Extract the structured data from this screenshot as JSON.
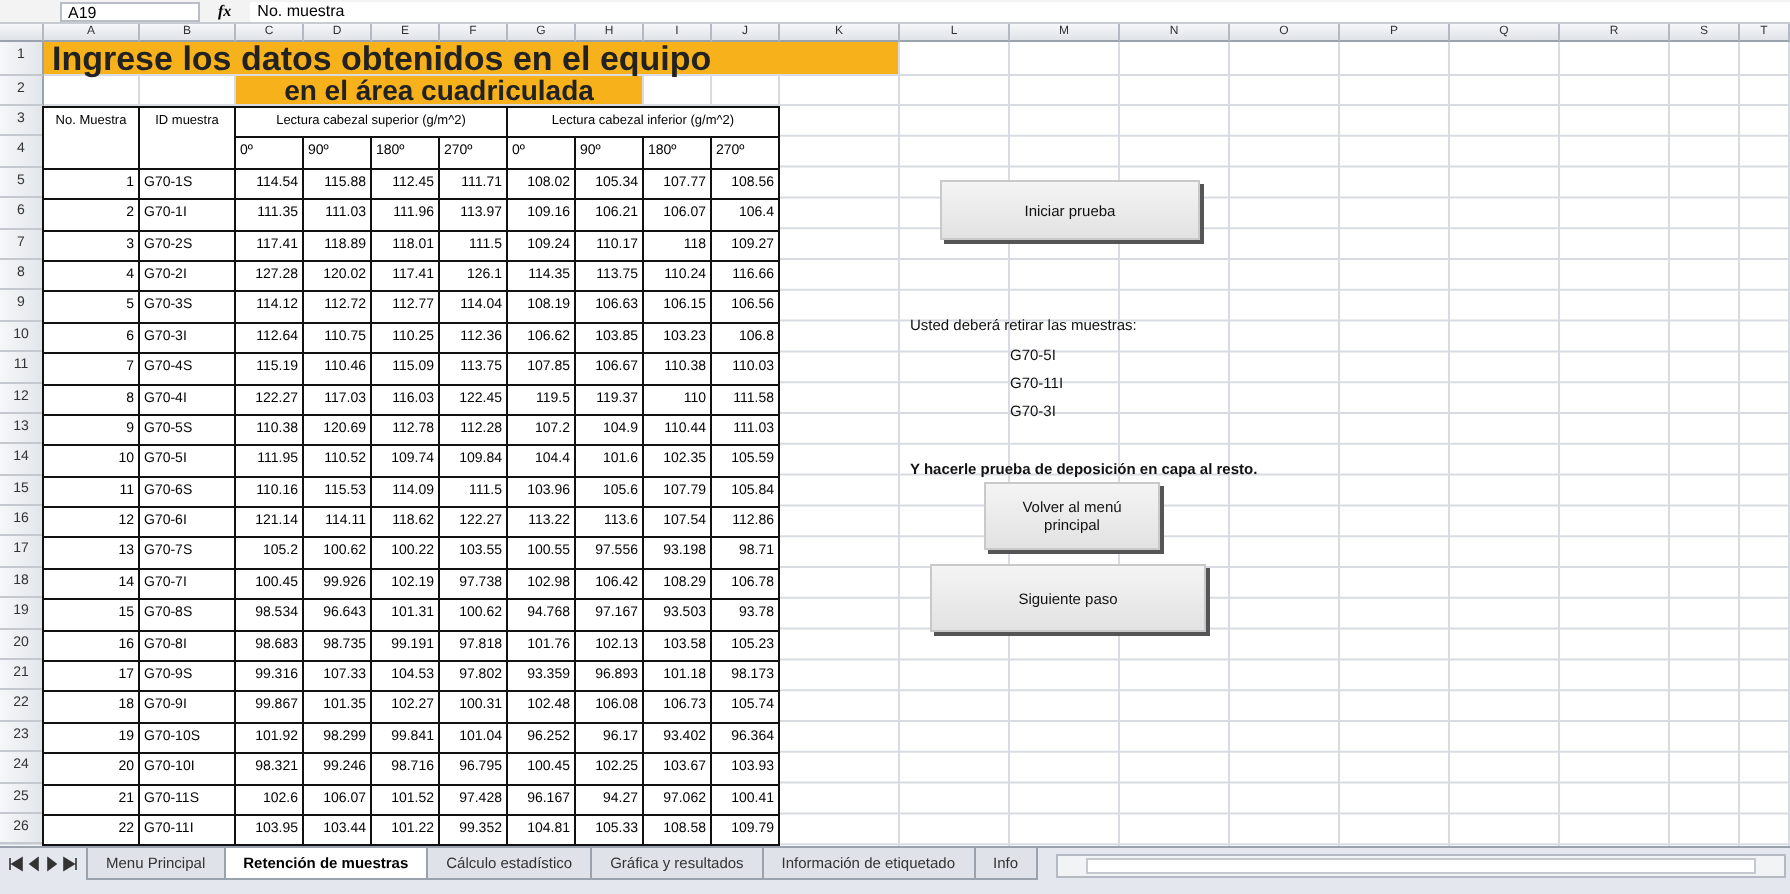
{
  "formula_bar": {
    "name_box": "A19",
    "function_label": "fx",
    "value": "No. muestra"
  },
  "row_numbers": [
    "1",
    "2",
    "3",
    "4",
    "5",
    "6",
    "7",
    "8",
    "9",
    "10",
    "11",
    "12",
    "13",
    "14",
    "15",
    "16",
    "17",
    "18",
    "19",
    "20",
    "21",
    "22",
    "23",
    "24",
    "25",
    "26"
  ],
  "columns": [
    "A",
    "B",
    "C",
    "D",
    "E",
    "F",
    "G",
    "H",
    "I",
    "J",
    "K",
    "L",
    "M",
    "N",
    "O",
    "P",
    "Q",
    "R",
    "S",
    "T"
  ],
  "title": {
    "line_1": "Ingrese los datos obtenidos en el equipo",
    "line_2": "en el área cuadriculada"
  },
  "table": {
    "headers": {
      "number": "No. Muestra",
      "id": "ID muestra",
      "upper": "Lectura cabezal superior (g/m^2)",
      "lower": "Lectura cabezal inferior (g/m^2)",
      "angles_upper": [
        "0º",
        "90º",
        "180º",
        "270º"
      ],
      "angles_lower": [
        "0º",
        "90º",
        "180º",
        "270º"
      ]
    },
    "rows": [
      [
        "1",
        "G70-1S",
        "114.54",
        "115.88",
        "112.45",
        "111.71",
        "108.02",
        "105.34",
        "107.77",
        "108.56"
      ],
      [
        "2",
        "G70-1I",
        "111.35",
        "111.03",
        "111.96",
        "113.97",
        "109.16",
        "106.21",
        "106.07",
        "106.4"
      ],
      [
        "3",
        "G70-2S",
        "117.41",
        "118.89",
        "118.01",
        "111.5",
        "109.24",
        "110.17",
        "118",
        "109.27"
      ],
      [
        "4",
        "G70-2I",
        "127.28",
        "120.02",
        "117.41",
        "126.1",
        "114.35",
        "113.75",
        "110.24",
        "116.66"
      ],
      [
        "5",
        "G70-3S",
        "114.12",
        "112.72",
        "112.77",
        "114.04",
        "108.19",
        "106.63",
        "106.15",
        "106.56"
      ],
      [
        "6",
        "G70-3I",
        "112.64",
        "110.75",
        "110.25",
        "112.36",
        "106.62",
        "103.85",
        "103.23",
        "106.8"
      ],
      [
        "7",
        "G70-4S",
        "115.19",
        "110.46",
        "115.09",
        "113.75",
        "107.85",
        "106.67",
        "110.38",
        "110.03"
      ],
      [
        "8",
        "G70-4I",
        "122.27",
        "117.03",
        "116.03",
        "122.45",
        "119.5",
        "119.37",
        "110",
        "111.58"
      ],
      [
        "9",
        "G70-5S",
        "110.38",
        "120.69",
        "112.78",
        "112.28",
        "107.2",
        "104.9",
        "110.44",
        "111.03"
      ],
      [
        "10",
        "G70-5I",
        "111.95",
        "110.52",
        "109.74",
        "109.84",
        "104.4",
        "101.6",
        "102.35",
        "105.59"
      ],
      [
        "11",
        "G70-6S",
        "110.16",
        "115.53",
        "114.09",
        "111.5",
        "103.96",
        "105.6",
        "107.79",
        "105.84"
      ],
      [
        "12",
        "G70-6I",
        "121.14",
        "114.11",
        "118.62",
        "122.27",
        "113.22",
        "113.6",
        "107.54",
        "112.86"
      ],
      [
        "13",
        "G70-7S",
        "105.2",
        "100.62",
        "100.22",
        "103.55",
        "100.55",
        "97.556",
        "93.198",
        "98.71"
      ],
      [
        "14",
        "G70-7I",
        "100.45",
        "99.926",
        "102.19",
        "97.738",
        "102.98",
        "106.42",
        "108.29",
        "106.78"
      ],
      [
        "15",
        "G70-8S",
        "98.534",
        "96.643",
        "101.31",
        "100.62",
        "94.768",
        "97.167",
        "93.503",
        "93.78"
      ],
      [
        "16",
        "G70-8I",
        "98.683",
        "98.735",
        "99.191",
        "97.818",
        "101.76",
        "102.13",
        "103.58",
        "105.23"
      ],
      [
        "17",
        "G70-9S",
        "99.316",
        "107.33",
        "104.53",
        "97.802",
        "93.359",
        "96.893",
        "101.18",
        "98.173"
      ],
      [
        "18",
        "G70-9I",
        "99.867",
        "101.35",
        "102.27",
        "100.31",
        "102.48",
        "106.08",
        "106.73",
        "105.74"
      ],
      [
        "19",
        "G70-10S",
        "101.92",
        "98.299",
        "99.841",
        "101.04",
        "96.252",
        "96.17",
        "93.402",
        "96.364"
      ],
      [
        "20",
        "G70-10I",
        "98.321",
        "99.246",
        "98.716",
        "96.795",
        "100.45",
        "102.25",
        "103.67",
        "103.93"
      ],
      [
        "21",
        "G70-11S",
        "102.6",
        "106.07",
        "101.52",
        "97.428",
        "96.167",
        "94.27",
        "97.062",
        "100.41"
      ],
      [
        "22",
        "G70-11I",
        "103.95",
        "103.44",
        "101.22",
        "99.352",
        "104.81",
        "105.33",
        "108.58",
        "109.79"
      ]
    ]
  },
  "panel": {
    "start_button": "Iniciar prueba",
    "instruction": "Usted deberá retirar las muestras:",
    "samples": [
      "G70-5I",
      "G70-11I",
      "G70-3I"
    ],
    "note": "Y hacerle prueba de deposición en capa al resto.",
    "back_button": "Volver al menú principal",
    "next_button": "Siguiente paso"
  },
  "sheet_tabs": [
    {
      "label": "Menu Principal",
      "selected": false
    },
    {
      "label": "Retención de muestras",
      "selected": true
    },
    {
      "label": "Cálculo estadístico",
      "selected": false
    },
    {
      "label": "Gráfica y resultados",
      "selected": false
    },
    {
      "label": "Información de etiquetado",
      "selected": false
    },
    {
      "label": "Info",
      "selected": false
    }
  ]
}
